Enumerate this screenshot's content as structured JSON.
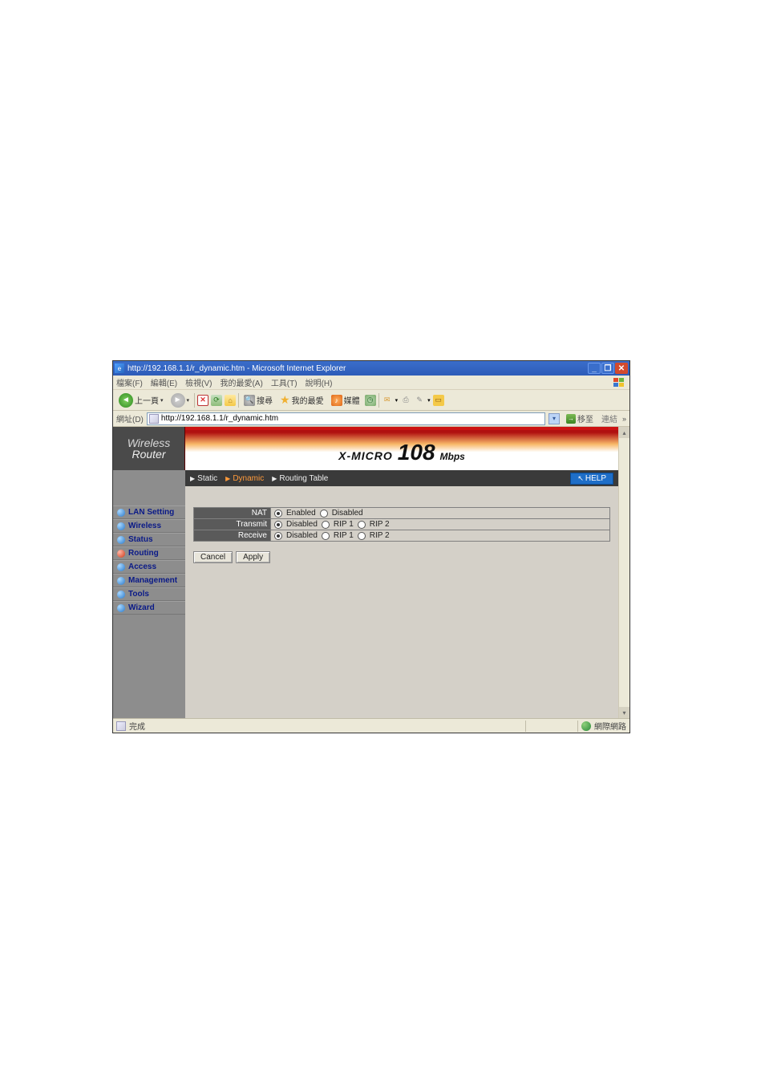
{
  "window": {
    "title": "http://192.168.1.1/r_dynamic.htm - Microsoft Internet Explorer"
  },
  "menubar": {
    "file": "檔案(F)",
    "edit": "編輯(E)",
    "view": "檢視(V)",
    "favorites": "我的最愛(A)",
    "tools": "工具(T)",
    "help": "說明(H)"
  },
  "toolbar": {
    "back": "上一頁",
    "search": "搜尋",
    "favorites": "我的最愛",
    "media": "媒體"
  },
  "addressbar": {
    "label": "網址(D)",
    "url": "http://192.168.1.1/r_dynamic.htm",
    "go": "移至",
    "links": "連結"
  },
  "branding": {
    "wireless": "Wireless",
    "router": "Router",
    "xmicro": "X-MICRO",
    "number": "108",
    "unit": "Mbps"
  },
  "tabs": {
    "static": "Static",
    "dynamic": "Dynamic",
    "routing_table": "Routing Table",
    "help": "HELP"
  },
  "sidebar": {
    "items": [
      {
        "label": "LAN Setting",
        "active": false
      },
      {
        "label": "Wireless",
        "active": false
      },
      {
        "label": "Status",
        "active": false
      },
      {
        "label": "Routing",
        "active": true
      },
      {
        "label": "Access",
        "active": false
      },
      {
        "label": "Management",
        "active": false
      },
      {
        "label": "Tools",
        "active": false
      },
      {
        "label": "Wizard",
        "active": false
      }
    ]
  },
  "form": {
    "nat": {
      "label": "NAT",
      "enabled": "Enabled",
      "disabled": "Disabled",
      "value": "Enabled"
    },
    "transmit": {
      "label": "Transmit",
      "disabled": "Disabled",
      "rip1": "RIP 1",
      "rip2": "RIP 2",
      "value": "Disabled"
    },
    "receive": {
      "label": "Receive",
      "disabled": "Disabled",
      "rip1": "RIP 1",
      "rip2": "RIP 2",
      "value": "Disabled"
    },
    "cancel": "Cancel",
    "apply": "Apply"
  },
  "statusbar": {
    "done": "完成",
    "zone": "網際網路"
  }
}
